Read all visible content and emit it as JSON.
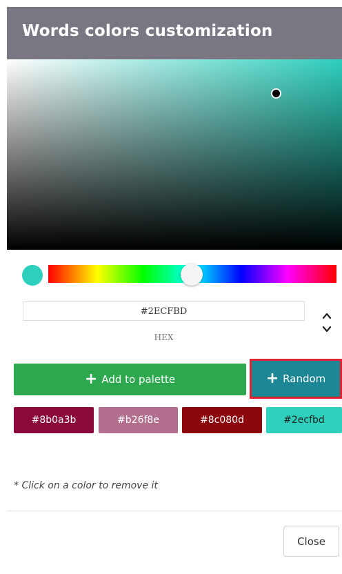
{
  "dialog": {
    "title": "Words colors customization",
    "current_hex": "#2ECFBD",
    "current_color": "#2ecfbd",
    "format_label": "HEX",
    "add_button": "Add to palette",
    "random_button": "Random",
    "note": "* Click on a color to remove it",
    "close_button": "Close",
    "icons": {
      "up_arrow": "chevron-up-icon",
      "down_arrow": "chevron-down-icon",
      "plus": "plus-icon"
    },
    "swatches": [
      {
        "label": "#8b0a3b",
        "bg": "#8b0a3b",
        "fg": "#ffffff"
      },
      {
        "label": "#b26f8e",
        "bg": "#b26f8e",
        "fg": "#ffffff"
      },
      {
        "label": "#8c080d",
        "bg": "#8c080d",
        "fg": "#ffffff"
      },
      {
        "label": "#2ecfbd",
        "bg": "#2ecfbd",
        "fg": "#222222"
      }
    ]
  }
}
